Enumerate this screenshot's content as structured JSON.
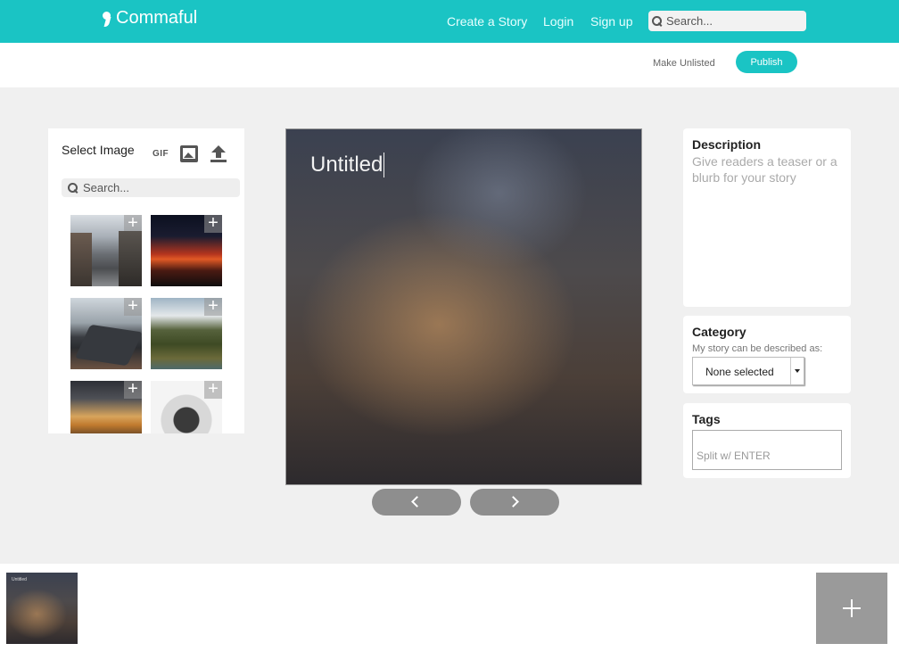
{
  "header": {
    "logo_text": "Commaful",
    "nav": {
      "create": "Create a Story",
      "login": "Login",
      "signup": "Sign up"
    },
    "search_placeholder": "Search..."
  },
  "actionbar": {
    "unlisted_label": "Make Unlisted",
    "publish_label": "Publish"
  },
  "image_panel": {
    "title": "Select Image",
    "gif_label": "GIF",
    "search_placeholder": "Search...",
    "add_symbol": "+",
    "thumbnails": [
      "street-photo",
      "red-sunset-sky",
      "laptop-on-desk",
      "mountain-valley",
      "pier-at-sunset",
      "white-monkey"
    ]
  },
  "story": {
    "title": "Untitled"
  },
  "description": {
    "title": "Description",
    "placeholder": "Give readers a teaser or a blurb for your story"
  },
  "category": {
    "title": "Category",
    "subtitle": "My story can be described as:",
    "selected": "None selected"
  },
  "tags": {
    "title": "Tags",
    "placeholder": "Split w/ ENTER"
  },
  "bottom": {
    "slide_title": "Untitled"
  },
  "colors": {
    "brand": "#1ac4c4",
    "button_gray": "#8e8e8e"
  }
}
